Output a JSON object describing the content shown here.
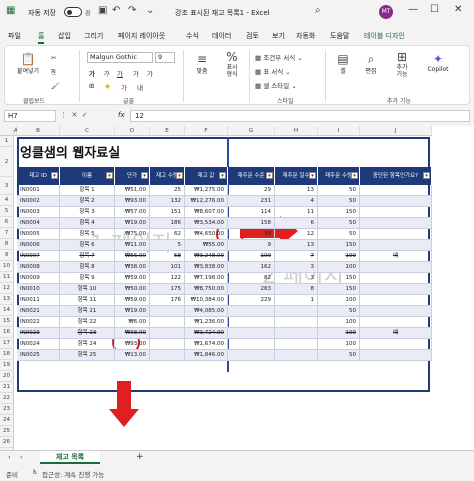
{
  "titlebar": {
    "autosave_label": "자동 저장",
    "autosave_state": "끔",
    "title": "강조 표시된 재고 목록1 - Excel",
    "user_initials": "MT"
  },
  "menu": [
    "파일",
    "홈",
    "삽입",
    "그리기",
    "페이지 레이아웃",
    "수식",
    "데이터",
    "검토",
    "보기",
    "자동화",
    "도움말",
    "테이블 디자인"
  ],
  "ribbon": {
    "paste": "붙여넣기",
    "clipboard": "클립보드",
    "font_name": "Malgun Gothic",
    "font_size": "9",
    "font_group": "글꼴",
    "align": "맞춤",
    "number": "표시 형식",
    "cond_format": "조건부 서식",
    "table_format": "표 서식",
    "cell_style": "셀 스타일",
    "style_group": "스타일",
    "cells": "셀",
    "edit": "편집",
    "addins": "추가 기능",
    "addins_group": "추가 기능",
    "copilot": "Copilot"
  },
  "formula": {
    "name_box": "H7",
    "value": "12"
  },
  "columns": [
    "A",
    "B",
    "C",
    "D",
    "E",
    "F",
    "G",
    "H",
    "I",
    "J"
  ],
  "rows": [
    "1",
    "2",
    "3",
    "4",
    "5",
    "6",
    "7",
    "8",
    "9",
    "10",
    "11",
    "12",
    "13",
    "14",
    "15",
    "16",
    "17",
    "18",
    "19",
    "20",
    "21",
    "22",
    "23",
    "24",
    "25",
    "26",
    "27",
    "28"
  ],
  "sheet": {
    "title": "엉클샘의 웹자료실",
    "headers": [
      "재고 ID",
      "이름",
      "단가",
      "재고 수량",
      "재고 값",
      "재주문 수준",
      "재주문 일수",
      "재주문 수량",
      "중단된 항목인가요?"
    ],
    "watermark1": "1 페이지",
    "watermark2": "2 페이지"
  },
  "table_rows": [
    {
      "id": "IN0001",
      "name": "항목 1",
      "price": "₩51.00",
      "qty": "25",
      "value": "₩1,275.00",
      "lvl": "29",
      "days": "13",
      "rq": "50",
      "disc": "",
      "strike": false
    },
    {
      "id": "IN0002",
      "name": "항목 2",
      "price": "₩93.00",
      "qty": "132",
      "value": "₩12,276.00",
      "lvl": "231",
      "days": "4",
      "rq": "50",
      "disc": "",
      "strike": false
    },
    {
      "id": "IN0003",
      "name": "항목 3",
      "price": "₩57.00",
      "qty": "151",
      "value": "₩8,607.00",
      "lvl": "114",
      "days": "11",
      "rq": "150",
      "disc": "",
      "strike": false
    },
    {
      "id": "IN0004",
      "name": "항목 4",
      "price": "₩19.00",
      "qty": "186",
      "value": "₩3,534.00",
      "lvl": "158",
      "days": "6",
      "rq": "50",
      "disc": "",
      "strike": false
    },
    {
      "id": "IN0005",
      "name": "항목 5",
      "price": "₩75.00",
      "qty": "62",
      "value": "₩4,650.00",
      "lvl": "39",
      "days": "12",
      "rq": "50",
      "disc": "",
      "strike": false
    },
    {
      "id": "IN0006",
      "name": "항목 6",
      "price": "₩11.00",
      "qty": "5",
      "value": "₩55.00",
      "lvl": "9",
      "days": "13",
      "rq": "150",
      "disc": "",
      "strike": false
    },
    {
      "id": "IN0007",
      "name": "항목 7",
      "price": "₩56.00",
      "qty": "58",
      "value": "₩3,248.00",
      "lvl": "109",
      "days": "7",
      "rq": "100",
      "disc": "예",
      "strike": true
    },
    {
      "id": "IN0008",
      "name": "항목 8",
      "price": "₩38.00",
      "qty": "101",
      "value": "₩3,838.00",
      "lvl": "162",
      "days": "3",
      "rq": "100",
      "disc": "",
      "strike": false
    },
    {
      "id": "IN0009",
      "name": "항목 9",
      "price": "₩59.00",
      "qty": "122",
      "value": "₩7,198.00",
      "lvl": "82",
      "days": "3",
      "rq": "150",
      "disc": "",
      "strike": false
    },
    {
      "id": "IN0010",
      "name": "항목 10",
      "price": "₩50.00",
      "qty": "175",
      "value": "₩8,750.00",
      "lvl": "283",
      "days": "8",
      "rq": "150",
      "disc": "",
      "strike": false
    },
    {
      "id": "IN0011",
      "name": "항목 11",
      "price": "₩59.00",
      "qty": "176",
      "value": "₩10,384.00",
      "lvl": "229",
      "days": "1",
      "rq": "100",
      "disc": "",
      "strike": false
    },
    {
      "id": "IN0021",
      "name": "항목 21",
      "price": "₩19.00",
      "qty": "",
      "value": "₩4,085.00",
      "lvl": "",
      "days": "",
      "rq": "50",
      "disc": "",
      "strike": false
    },
    {
      "id": "IN0022",
      "name": "항목 22",
      "price": "₩6.00",
      "qty": "",
      "value": "₩1,236.00",
      "lvl": "",
      "days": "",
      "rq": "100",
      "disc": "",
      "strike": false
    },
    {
      "id": "IN0023",
      "name": "항목 23",
      "price": "₩38.00",
      "qty": "",
      "value": "₩3,724.00",
      "lvl": "",
      "days": "",
      "rq": "100",
      "disc": "예",
      "strike": true
    },
    {
      "id": "IN0024",
      "name": "항목 24",
      "price": "₩93.00",
      "qty": "",
      "value": "₩1,674.00",
      "lvl": "",
      "days": "",
      "rq": "100",
      "disc": "",
      "strike": false
    },
    {
      "id": "IN0025",
      "name": "항목 25",
      "price": "₩13.00",
      "qty": "",
      "value": "₩1,846.00",
      "lvl": "",
      "days": "",
      "rq": "50",
      "disc": "",
      "strike": false
    }
  ],
  "tabs": {
    "sheet_name": "재고 목록",
    "add": "+"
  },
  "status": {
    "ready": "준비",
    "accessibility": "접근성: 계속 진행 가능"
  }
}
